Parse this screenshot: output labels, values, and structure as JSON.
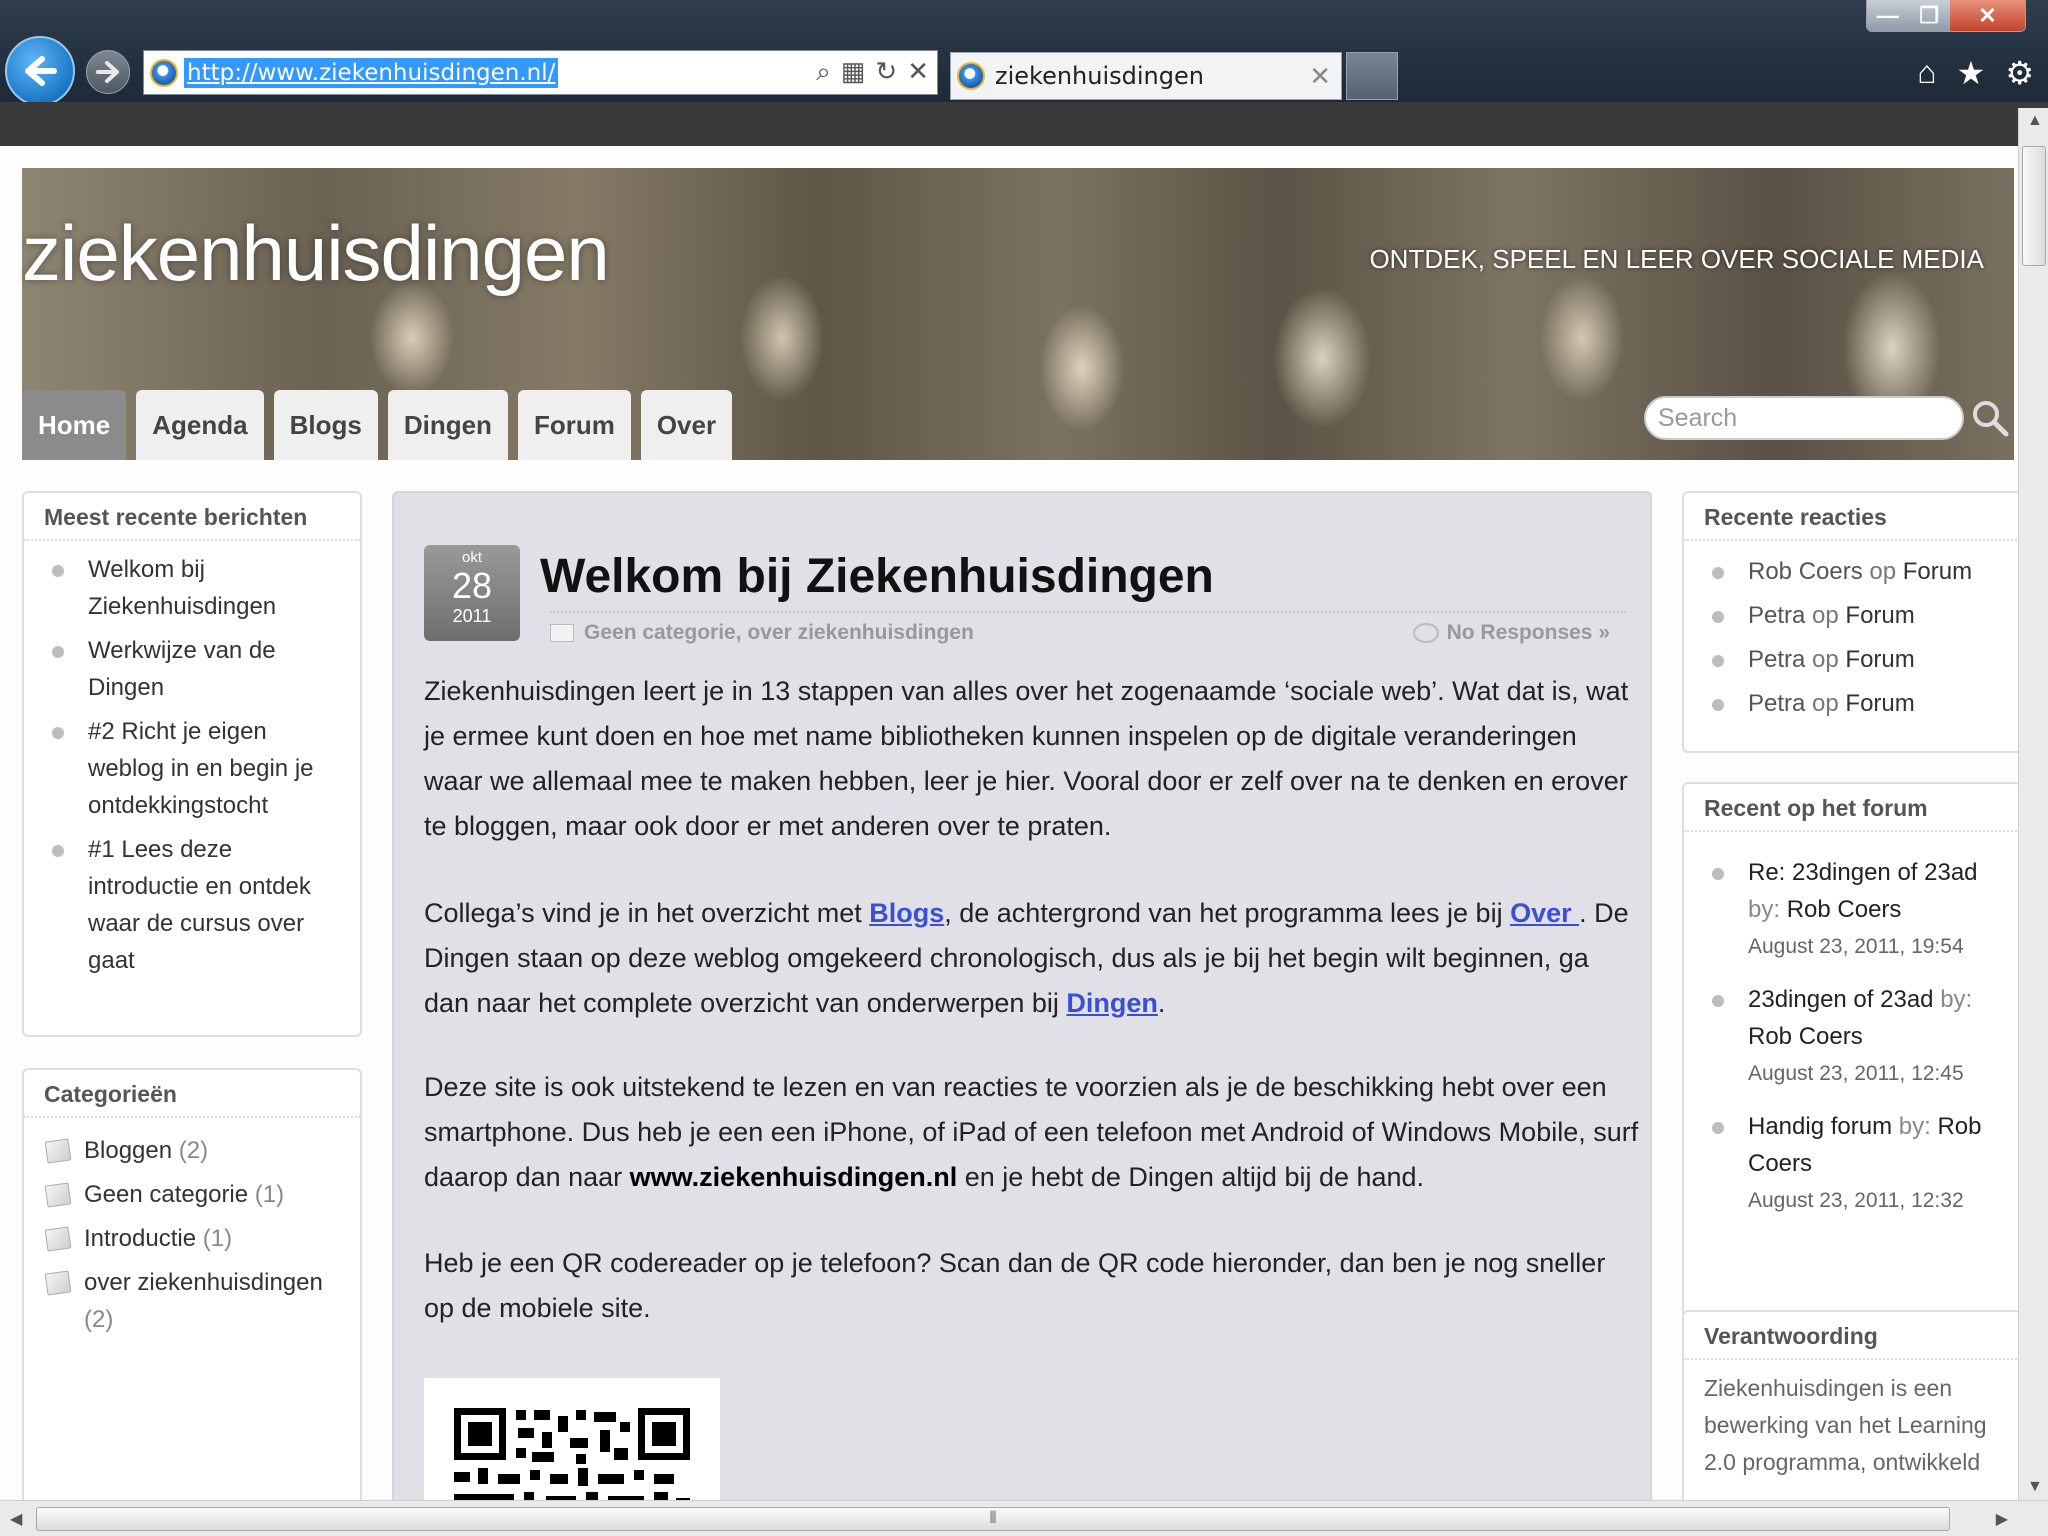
{
  "browser": {
    "url": "http://www.ziekenhuisdingen.nl/",
    "tab_title": "ziekenhuisdingen",
    "window_min": "—",
    "window_max": "❐",
    "window_close": "✕",
    "icons": [
      "back-arrow-icon",
      "forward-arrow-icon",
      "ie-logo-icon",
      "search-icon",
      "compat-view-icon",
      "refresh-icon",
      "stop-icon",
      "home-icon",
      "favorites-star-icon",
      "tools-gear-icon"
    ],
    "accent": "#3399ff"
  },
  "header": {
    "site_title": "ziekenhuisdingen",
    "tagline": "ONTDEK, SPEEL EN LEER OVER SOCIALE MEDIA",
    "nav": [
      "Home",
      "Agenda",
      "Blogs",
      "Dingen",
      "Forum",
      "Over"
    ],
    "active_nav": "Home",
    "search_placeholder": "Search"
  },
  "sidebar_left": {
    "recent_posts": {
      "title": "Meest recente berichten",
      "items": [
        "Welkom bij Ziekenhuisdingen",
        "Werkwijze van de Dingen",
        "#2 Richt je eigen weblog in en begin je ontdekkingstocht",
        "#1 Lees deze introductie en ontdek waar de cursus over gaat"
      ]
    },
    "categories": {
      "title": "Categorieën",
      "items": [
        {
          "name": "Bloggen",
          "count": "(2)"
        },
        {
          "name": "Geen categorie",
          "count": "(1)"
        },
        {
          "name": "Introductie",
          "count": "(1)"
        },
        {
          "name": "over ziekenhuisdingen",
          "count": "(2)"
        }
      ]
    }
  },
  "post": {
    "date_month": "okt",
    "date_day": "28",
    "date_year": "2011",
    "title": "Welkom bij Ziekenhuisdingen",
    "categories": "Geen categorie, over ziekenhuisdingen",
    "responses": "No Responses »",
    "p1": "Ziekenhuisdingen leert je in 13 stappen van alles over het zogenaamde ‘sociale web’. Wat dat is, wat je ermee kunt doen en hoe met name bibliotheken kunnen inspelen op de digitale veranderingen waar we allemaal mee te maken hebben, leer je hier. Vooral door er zelf over na te denken en erover te bloggen, maar ook door er met anderen over te praten.",
    "p2_a": "Collega’s vind je in het overzicht met ",
    "p2_link1": "Blogs",
    "p2_b": ", de achtergrond van het programma lees je bij ",
    "p2_link2": "Over ",
    "p2_c": ". De Dingen staan op deze weblog omgekeerd chronologisch, dus als je bij het begin wilt beginnen, ga dan naar het complete overzicht van onderwerpen bij ",
    "p2_link3": "Dingen",
    "p2_d": ".",
    "p3_a": "Deze site is ook uitstekend te lezen en van reacties te voorzien als je de beschikking hebt over een smartphone. Dus heb je een een iPhone, of iPad of een telefoon met Android of Windows Mobile, surf daarop dan naar ",
    "p3_bold": "www.ziekenhuisdingen.nl",
    "p3_b": " en je hebt de Dingen altijd bij de hand.",
    "p4": "Heb je een QR codereader op je telefoon? Scan dan de QR code hieronder, dan ben je nog sneller op de mobiele site."
  },
  "sidebar_right": {
    "recent_comments": {
      "title": "Recente reacties",
      "op": "op",
      "items": [
        {
          "author": "Rob Coers",
          "post": "Forum"
        },
        {
          "author": "Petra",
          "post": "Forum"
        },
        {
          "author": "Petra",
          "post": "Forum"
        },
        {
          "author": "Petra",
          "post": "Forum"
        }
      ]
    },
    "forum": {
      "title": "Recent op het forum",
      "by": "by:",
      "items": [
        {
          "topic": "Re: 23dingen of 23ad",
          "author": "Rob Coers",
          "date": "August 23, 2011, 19:54"
        },
        {
          "topic": "23dingen of 23ad",
          "author": "Rob Coers",
          "date": "August 23, 2011, 12:45"
        },
        {
          "topic": "Handig forum",
          "author": "Rob Coers",
          "date": "August 23, 2011, 12:32"
        }
      ]
    },
    "accountability": {
      "title": "Verantwoording",
      "text": "Ziekenhuisdingen is een bewerking van het Learning 2.0 programma, ontwikkeld"
    }
  }
}
